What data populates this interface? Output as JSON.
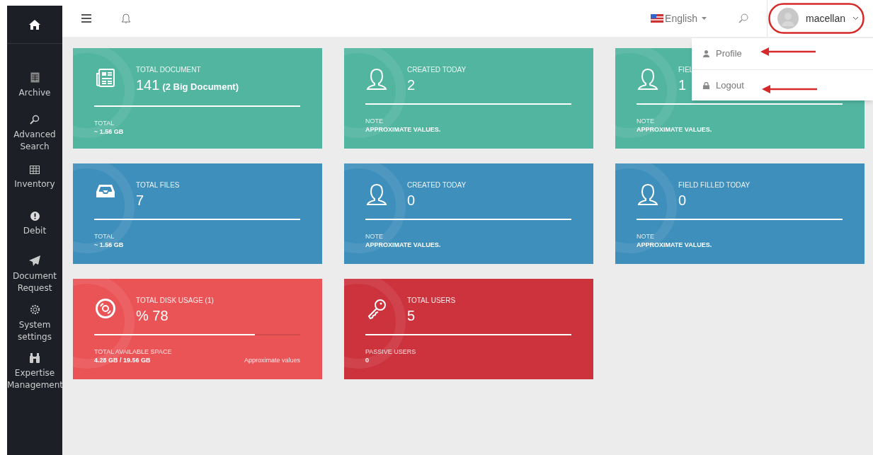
{
  "sidebar": {
    "items": [
      {
        "label": "Archive"
      },
      {
        "label": "Advanced Search"
      },
      {
        "label": "Inventory"
      },
      {
        "label": "Debit"
      },
      {
        "label": "Document Request"
      },
      {
        "label": "System settings"
      },
      {
        "label": "Expertise Management"
      }
    ]
  },
  "header": {
    "language": "English",
    "user": "macellan"
  },
  "user_menu": {
    "items": [
      {
        "label": "Profile"
      },
      {
        "label": "Logout"
      }
    ]
  },
  "cards": [
    {
      "title": "TOTAL DOCUMENT",
      "value": "141",
      "value_note": "(2 Big Document)",
      "footer_label": "TOTAL",
      "footer_value": "~ 1.56 GB",
      "color": "#52b5a0"
    },
    {
      "title": "CREATED TODAY",
      "value": "2",
      "footer_label": "NOTE",
      "footer_value": "APPROXIMATE VALUES.",
      "color": "#52b5a0"
    },
    {
      "title": "FIEL",
      "value": "1",
      "footer_label": "NOTE",
      "footer_value": "APPROXIMATE VALUES.",
      "color": "#52b5a0"
    },
    {
      "title": "TOTAL FILES",
      "value": "7",
      "footer_label": "TOTAL",
      "footer_value": "~ 1.56 GB",
      "color": "#3e8fbb"
    },
    {
      "title": "CREATED TODAY",
      "value": "0",
      "footer_label": "NOTE",
      "footer_value": "APPROXIMATE VALUES.",
      "color": "#3e8fbb"
    },
    {
      "title": "FIELD FILLED TODAY",
      "value": "0",
      "footer_label": "NOTE",
      "footer_value": "APPROXIMATE VALUES.",
      "color": "#3e8fbb"
    },
    {
      "title": "TOTAL DISK USAGE (1)",
      "value": "% 78",
      "level": 0.78,
      "footer_label": "TOTAL AVAILABLE SPACE",
      "footer_value": "4.28 GB / 19.56 GB",
      "aside": "Approximate values",
      "color": "#ea5457"
    },
    {
      "title": "TOTAL USERS",
      "value": "5",
      "footer_label": "PASSIVE USERS",
      "footer_value": "0",
      "color": "#cc333d"
    }
  ]
}
